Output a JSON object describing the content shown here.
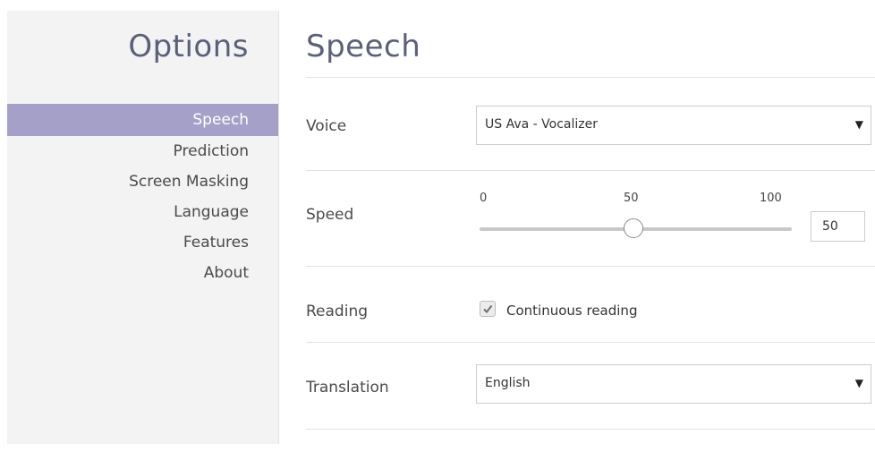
{
  "sidebar": {
    "title": "Options",
    "items": [
      {
        "label": "Speech",
        "active": true
      },
      {
        "label": "Prediction",
        "active": false
      },
      {
        "label": "Screen Masking",
        "active": false
      },
      {
        "label": "Language",
        "active": false
      },
      {
        "label": "Features",
        "active": false
      },
      {
        "label": "About",
        "active": false
      }
    ]
  },
  "main": {
    "title": "Speech",
    "voice": {
      "label": "Voice",
      "value": "US Ava - Vocalizer",
      "caret_icon": "caret-down-icon"
    },
    "speed": {
      "label": "Speed",
      "min_label": "0",
      "mid_label": "50",
      "max_label": "100",
      "value": 50,
      "input_value": "50"
    },
    "reading": {
      "label": "Reading",
      "checkbox_label": "Continuous reading",
      "checked": true,
      "check_icon": "checkmark-icon"
    },
    "translation": {
      "label": "Translation",
      "value": "English",
      "caret_icon": "caret-down-icon"
    }
  },
  "colors": {
    "accent": "#a5a0c8",
    "title": "#5a6079",
    "sidebar_bg": "#f3f3f3"
  }
}
